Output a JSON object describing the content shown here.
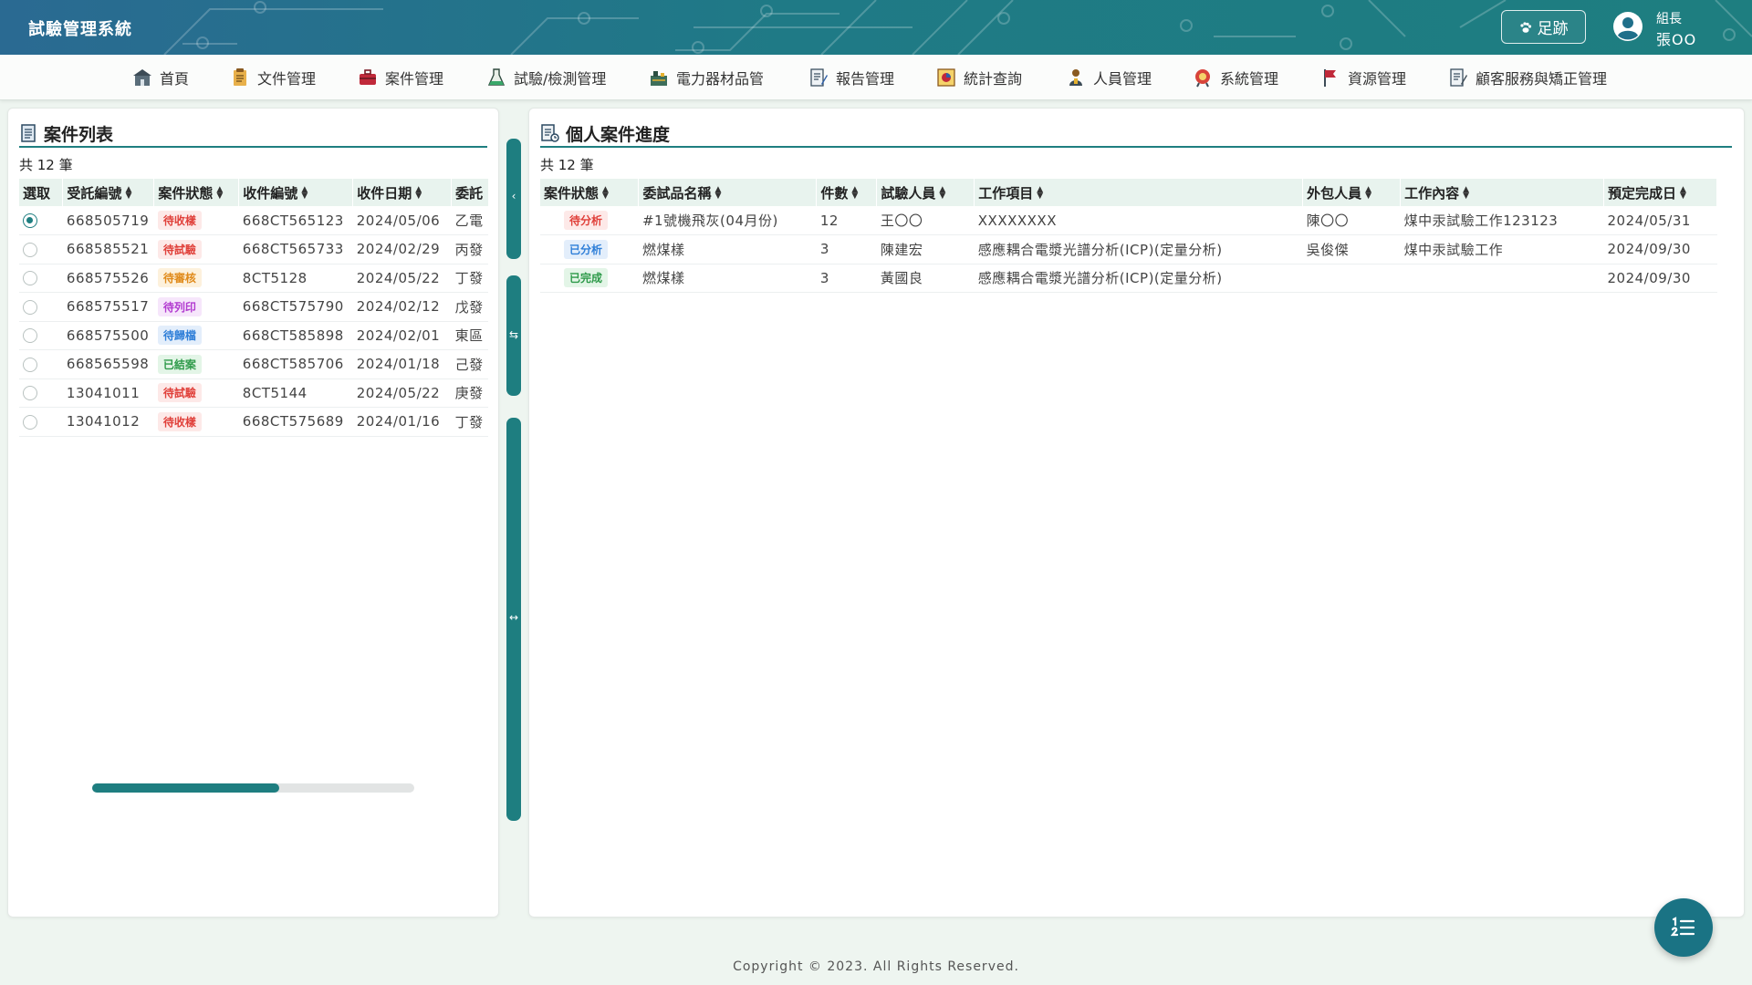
{
  "app": {
    "title": "試驗管理系統"
  },
  "header": {
    "footprint_label": "足跡",
    "user_role": "組長",
    "user_name": "張OO"
  },
  "nav": {
    "items": [
      {
        "label": "首頁",
        "icon": "home-icon"
      },
      {
        "label": "文件管理",
        "icon": "document-icon"
      },
      {
        "label": "案件管理",
        "icon": "briefcase-icon"
      },
      {
        "label": "試驗/檢測管理",
        "icon": "flask-icon"
      },
      {
        "label": "電力器材品管",
        "icon": "equipment-icon"
      },
      {
        "label": "報告管理",
        "icon": "report-icon"
      },
      {
        "label": "統計查詢",
        "icon": "chart-icon"
      },
      {
        "label": "人員管理",
        "icon": "person-icon"
      },
      {
        "label": "系統管理",
        "icon": "gear-icon"
      },
      {
        "label": "資源管理",
        "icon": "flag-icon"
      },
      {
        "label": "顧客服務與矯正管理",
        "icon": "service-icon"
      }
    ]
  },
  "case_list": {
    "title": "案件列表",
    "count_text": "共 12 筆",
    "columns": [
      "選取",
      "受託編號",
      "案件狀態",
      "收件編號",
      "收件日期",
      "委託"
    ],
    "rows": [
      {
        "selected": true,
        "no": "668505719",
        "status": "待收樣",
        "recv_no": "668CT565123",
        "date": "2024/05/06",
        "client": "乙電"
      },
      {
        "selected": false,
        "no": "668585521",
        "status": "待試驗",
        "recv_no": "668CT565733",
        "date": "2024/02/29",
        "client": "丙發"
      },
      {
        "selected": false,
        "no": "668575526",
        "status": "待審核",
        "recv_no": "8CT5128",
        "date": "2024/05/22",
        "client": "丁發"
      },
      {
        "selected": false,
        "no": "668575517",
        "status": "待列印",
        "recv_no": "668CT575790",
        "date": "2024/02/12",
        "client": "戊發"
      },
      {
        "selected": false,
        "no": "668575500",
        "status": "待歸檔",
        "recv_no": "668CT585898",
        "date": "2024/02/01",
        "client": "東區"
      },
      {
        "selected": false,
        "no": "668565598",
        "status": "已結案",
        "recv_no": "668CT585706",
        "date": "2024/01/18",
        "client": "己發"
      },
      {
        "selected": false,
        "no": "13041011",
        "status": "待試驗",
        "recv_no": "8CT5144",
        "date": "2024/05/22",
        "client": "庚發"
      },
      {
        "selected": false,
        "no": "13041012",
        "status": "待收樣",
        "recv_no": "668CT575689",
        "date": "2024/01/16",
        "client": "丁發"
      }
    ],
    "scroll_position": 0.58
  },
  "personal_progress": {
    "title": "個人案件進度",
    "count_text": "共 12 筆",
    "columns": [
      "案件狀態",
      "委試品名稱",
      "件數",
      "試驗人員",
      "工作項目",
      "外包人員",
      "工作內容",
      "預定完成日"
    ],
    "rows": [
      {
        "status": "待分析",
        "item_name": "#1號機飛灰(04月份)",
        "qty": "12",
        "tester": "王〇〇",
        "work_item": "XXXXXXXX",
        "outsource": "陳〇〇",
        "content": "煤中汞試驗工作123123",
        "due": "2024/05/31"
      },
      {
        "status": "已分析",
        "item_name": "燃煤樣",
        "qty": "3",
        "tester": "陳建宏",
        "work_item": "感應耦合電漿光譜分析(ICP)(定量分析)",
        "outsource": "吳俊傑",
        "content": "煤中汞試驗工作",
        "due": "2024/09/30"
      },
      {
        "status": "已完成",
        "item_name": "燃煤樣",
        "qty": "3",
        "tester": "黃國良",
        "work_item": "感應耦合電漿光譜分析(ICP)(定量分析)",
        "outsource": "",
        "content": "",
        "due": "2024/09/30"
      }
    ]
  },
  "status_colors": {
    "待收樣": {
      "fg": "#e0403a",
      "bg": "#fde9e8"
    },
    "待試驗": {
      "fg": "#e0403a",
      "bg": "#fde9e8"
    },
    "待審核": {
      "fg": "#e08a1a",
      "bg": "#fdf1dc"
    },
    "待列印": {
      "fg": "#b23bd0",
      "bg": "#f6e6fb"
    },
    "待歸檔": {
      "fg": "#2f7fd8",
      "bg": "#e3eefb"
    },
    "已結案": {
      "fg": "#2e9a4a",
      "bg": "#e3f5e7"
    },
    "待分析": {
      "fg": "#e0403a",
      "bg": "#fde9e8"
    },
    "已分析": {
      "fg": "#2f7fd8",
      "bg": "#e3eefb"
    },
    "已完成": {
      "fg": "#2e9a4a",
      "bg": "#e3f5e7"
    }
  },
  "theme": {
    "accent": "#1e7e80",
    "header_bg": "#2a6a92"
  },
  "footer": {
    "copyright": "Copyright © 2023. All Rights Reserved."
  }
}
